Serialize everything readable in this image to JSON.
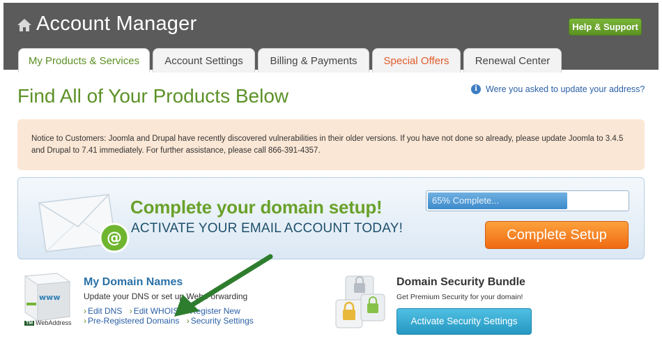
{
  "header": {
    "title": "Account Manager",
    "help_label": "Help & Support"
  },
  "tabs": [
    {
      "label": "My Products & Services"
    },
    {
      "label": "Account Settings"
    },
    {
      "label": "Billing & Payments"
    },
    {
      "label": "Special Offers"
    },
    {
      "label": "Renewal Center"
    }
  ],
  "main": {
    "title": "Find All of Your Products Below",
    "address_link": "Were you asked to update your address?",
    "notice": "Notice to Customers: Joomla and Drupal have recently discovered vulnerabilities in their older versions. If you have not done so already, please update Joomla to 3.4.5 and Drupal to 7.41 immediately. For further assistance, please call 866-391-4357."
  },
  "banner": {
    "headline": "Complete your domain setup!",
    "subheadline": "ACTIVATE YOUR EMAIL ACCOUNT TODAY!",
    "progress_label": "65% Complete...",
    "progress_value": 0.7,
    "button_label": "Complete Setup"
  },
  "domains": {
    "logo_text": "www",
    "brand_mark": "TM",
    "brand": "WebAddress",
    "title": "My Domain Names",
    "subtitle": "Update your DNS or set up Web Forwarding",
    "links": [
      "Edit DNS",
      "Edit WHOIS",
      "Register New",
      "Pre-Registered Domains",
      "Security Settings"
    ]
  },
  "security": {
    "title": "Domain Security Bundle",
    "subtitle": "Get Premium Security for your domain!",
    "button_label": "Activate Security Settings"
  },
  "colors": {
    "header_bg": "#5b5b5b",
    "brand_green": "#5c9128",
    "accent_orange": "#f06a12",
    "link_blue": "#2a5fa7",
    "notice_bg": "#fbe7d5"
  }
}
